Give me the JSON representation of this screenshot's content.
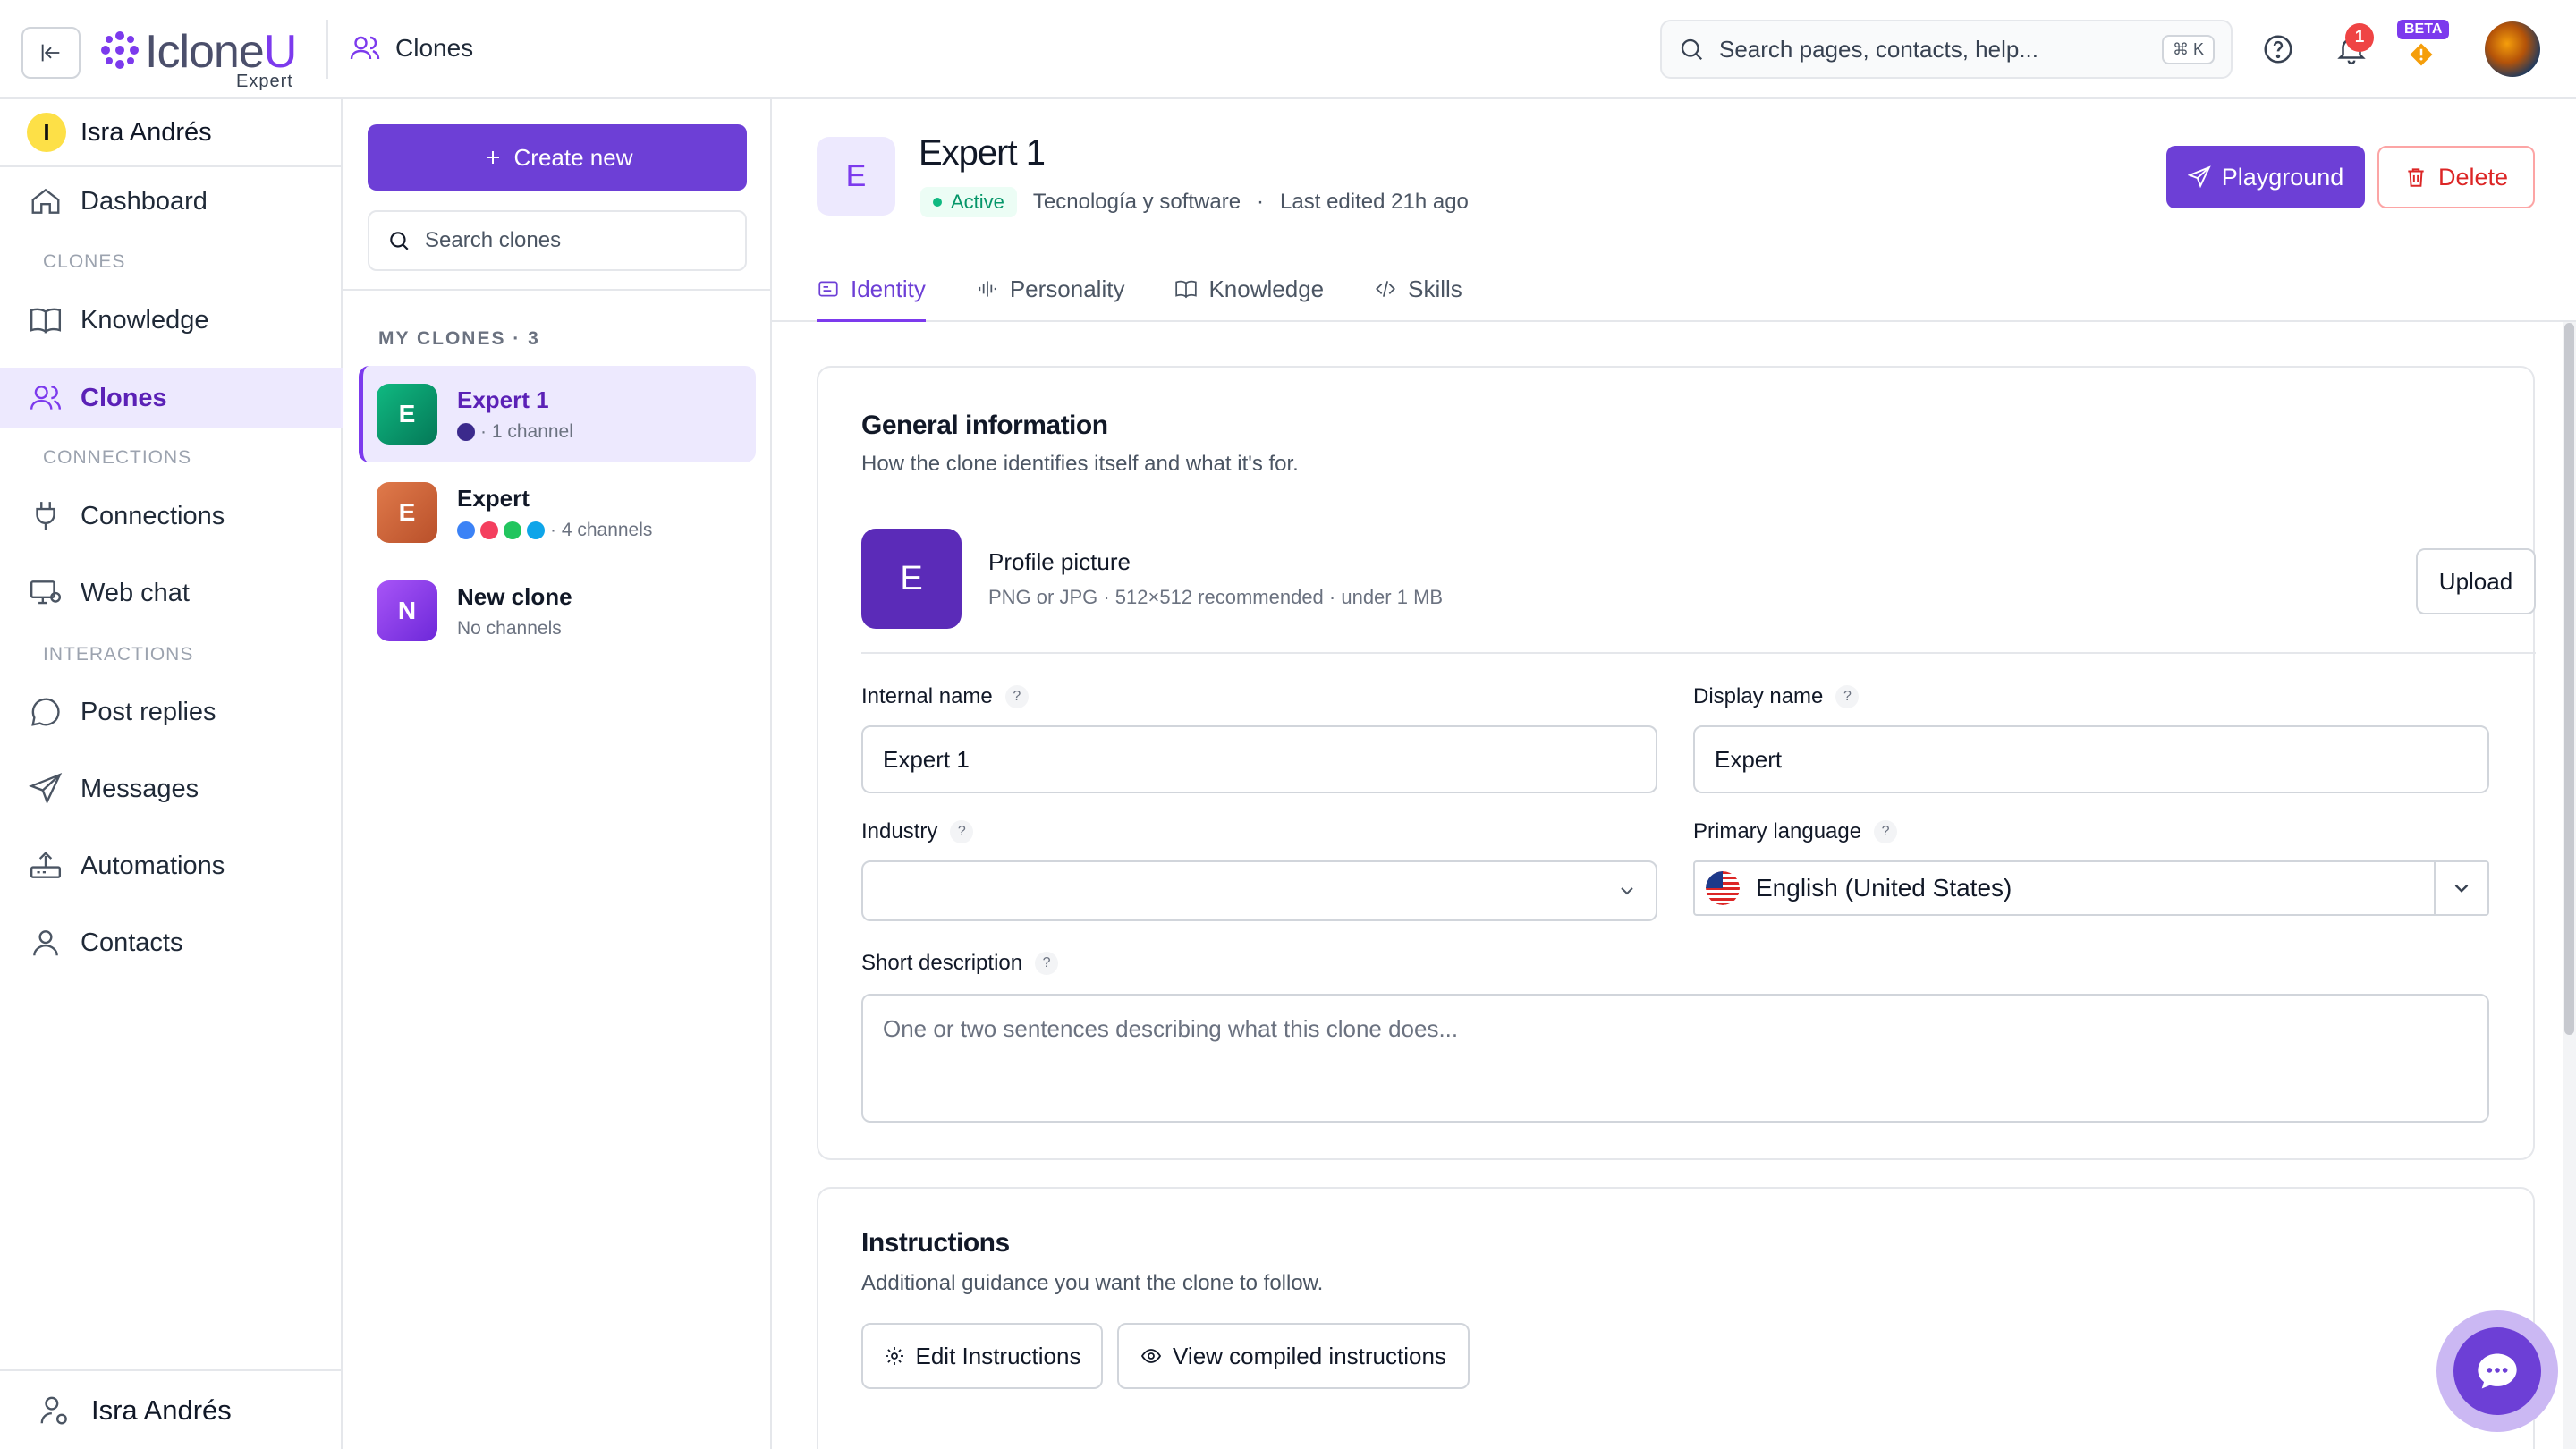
{
  "header": {
    "logo_text_prefix": "Iclone",
    "logo_text_suffix": "U",
    "logo_sub": "Expert",
    "breadcrumb": "Clones",
    "search_placeholder": "Search pages, contacts, help...",
    "search_shortcut": "⌘ K",
    "notification_count": "1",
    "beta_label": "BETA"
  },
  "sidebar": {
    "user_initial": "I",
    "user_name": "Isra Andrés",
    "items": [
      {
        "label": "Dashboard",
        "icon": "home-icon"
      },
      {
        "label": "Knowledge",
        "icon": "book-icon"
      },
      {
        "label": "Clones",
        "icon": "users-icon"
      },
      {
        "label": "Connections",
        "icon": "plug-icon"
      },
      {
        "label": "Web chat",
        "icon": "monitor-chat-icon"
      },
      {
        "label": "Post replies",
        "icon": "comment-icon"
      },
      {
        "label": "Messages",
        "icon": "send-icon"
      },
      {
        "label": "Automations",
        "icon": "router-icon"
      },
      {
        "label": "Contacts",
        "icon": "user-icon"
      }
    ],
    "sections": [
      "CLONES",
      "CONNECTIONS",
      "INTERACTIONS"
    ],
    "footer_name": "Isra Andrés"
  },
  "clones_panel": {
    "create_label": "Create new",
    "search_placeholder": "Search clones",
    "heading": "MY CLONES · 3",
    "clones": [
      {
        "initial": "E",
        "name": "Expert 1",
        "meta": "· 1 channel",
        "color": "#10b981"
      },
      {
        "initial": "E",
        "name": "Expert",
        "meta": "· 4 channels",
        "color": "#d9693f"
      },
      {
        "initial": "N",
        "name": "New clone",
        "meta": "No channels",
        "color": "#8b5cf6"
      }
    ],
    "channel_colors_1": [
      "#3b2a8c"
    ],
    "channel_colors_2": [
      "#3b82f6",
      "#f43f5e",
      "#22c55e",
      "#0ea5e9"
    ]
  },
  "main": {
    "avatar_initial": "E",
    "title": "Expert 1",
    "status": "Active",
    "industry": "Tecnología y software",
    "separator": "·",
    "last_edited": "Last edited 21h ago",
    "playground_label": "Playground",
    "delete_label": "Delete",
    "tabs": [
      {
        "label": "Identity",
        "icon": "id-card-icon"
      },
      {
        "label": "Personality",
        "icon": "waveform-icon"
      },
      {
        "label": "Knowledge",
        "icon": "book-icon"
      },
      {
        "label": "Skills",
        "icon": "code-icon"
      }
    ],
    "general": {
      "title": "General information",
      "subtitle": "How the clone identifies itself and what it's for.",
      "pp_initial": "E",
      "pp_title": "Profile picture",
      "pp_sub": "PNG or JPG · 512×512 recommended · under 1 MB",
      "upload_label": "Upload",
      "internal_name_label": "Internal name",
      "internal_name_value": "Expert 1",
      "display_name_label": "Display name",
      "display_name_value": "Expert",
      "industry_label": "Industry",
      "industry_value": "",
      "language_label": "Primary language",
      "language_value": "English (United States)",
      "description_label": "Short description",
      "description_placeholder": "One or two sentences describing what this clone does...",
      "help_mark": "?"
    },
    "instructions": {
      "title": "Instructions",
      "subtitle": "Additional guidance you want the clone to follow.",
      "edit_label": "Edit Instructions",
      "view_label": "View compiled instructions"
    }
  },
  "colors": {
    "accent": "#6d3fd6",
    "active_bg": "#ede9fe",
    "danger": "#dc2626",
    "success": "#059669"
  }
}
